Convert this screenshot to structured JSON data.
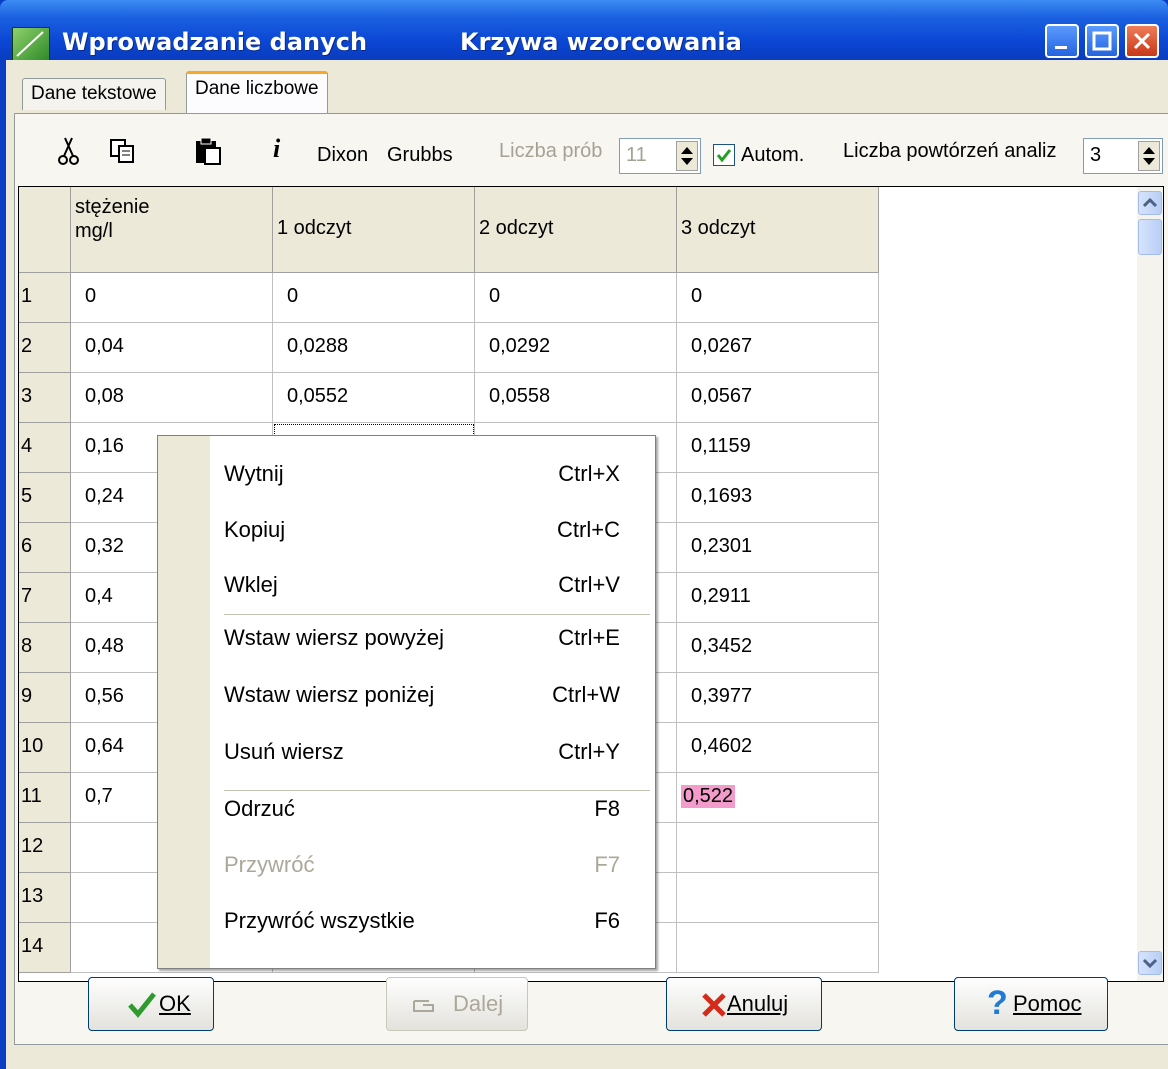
{
  "window": {
    "title_left": "Wprowadzanie danych",
    "title_right": "Krzywa wzorcowania",
    "app_icon": "chart-icon",
    "controls": [
      "minimize-icon",
      "maximize-icon",
      "close-icon"
    ]
  },
  "tabs": [
    {
      "label": "Dane tekstowe",
      "active": false
    },
    {
      "label": "Dane liczbowe",
      "active": true
    }
  ],
  "toolbar": {
    "icons": [
      "scissors-icon",
      "copy-icon",
      "paste-icon",
      "info-icon"
    ],
    "dixon": "Dixon",
    "grubbs": "Grubbs",
    "samples_label": "Liczba prób",
    "samples_value": "11",
    "autom_label": "Autom.",
    "autom_checked": true,
    "repeats_label": "Liczba powtórzeń analiz",
    "repeats_value": "3"
  },
  "table": {
    "headers": [
      "stężenie\nmg/l",
      "1 odczyt",
      "2 odczyt",
      "3 odczyt"
    ],
    "rows": [
      {
        "num": "1",
        "c": "0",
        "r1": "0",
        "r2": "0",
        "r3": "0"
      },
      {
        "num": "2",
        "c": "0,04",
        "r1": "0,0288",
        "r2": "0,0292",
        "r3": "0,0267"
      },
      {
        "num": "3",
        "c": "0,08",
        "r1": "0,0552",
        "r2": "0,0558",
        "r3": "0,0567"
      },
      {
        "num": "4",
        "c": "0,16",
        "r1": "",
        "r2": "",
        "r3": "0,1159"
      },
      {
        "num": "5",
        "c": "0,24",
        "r1": "",
        "r2": "",
        "r3": "0,1693"
      },
      {
        "num": "6",
        "c": "0,32",
        "r1": "",
        "r2": "",
        "r3": "0,2301"
      },
      {
        "num": "7",
        "c": "0,4",
        "r1": "",
        "r2": "",
        "r3": "0,2911"
      },
      {
        "num": "8",
        "c": "0,48",
        "r1": "",
        "r2": "",
        "r3": "0,3452"
      },
      {
        "num": "9",
        "c": "0,56",
        "r1": "",
        "r2": "",
        "r3": "0,3977"
      },
      {
        "num": "10",
        "c": "0,64",
        "r1": "",
        "r2": "",
        "r3": "0,4602"
      },
      {
        "num": "11",
        "c": "0,7",
        "r1": "",
        "r2": "",
        "r3": "0,522"
      },
      {
        "num": "12",
        "c": "",
        "r1": "",
        "r2": "",
        "r3": ""
      },
      {
        "num": "13",
        "c": "",
        "r1": "",
        "r2": "",
        "r3": ""
      },
      {
        "num": "14",
        "c": "",
        "r1": "",
        "r2": "",
        "r3": ""
      }
    ],
    "highlight_color": "#f39ccb"
  },
  "context_menu": {
    "items": [
      {
        "label": "Wytnij",
        "shortcut": "Ctrl+X",
        "disabled": false
      },
      {
        "label": "Kopiuj",
        "shortcut": "Ctrl+C",
        "disabled": false
      },
      {
        "label": "Wklej",
        "shortcut": "Ctrl+V",
        "disabled": false
      },
      {
        "label": "Wstaw wiersz powyżej",
        "shortcut": "Ctrl+E",
        "disabled": false
      },
      {
        "label": "Wstaw wiersz poniżej",
        "shortcut": "Ctrl+W",
        "disabled": false
      },
      {
        "label": "Usuń wiersz",
        "shortcut": "Ctrl+Y",
        "disabled": false
      },
      {
        "label": "Odrzuć",
        "shortcut": "F8",
        "disabled": false
      },
      {
        "label": "Przywróć",
        "shortcut": "F7",
        "disabled": true
      },
      {
        "label": "Przywróć wszystkie",
        "shortcut": "F6",
        "disabled": false
      }
    ]
  },
  "buttons": {
    "ok": "OK",
    "next": "Dalej",
    "cancel": "Anuluj",
    "help": "Pomoc"
  }
}
